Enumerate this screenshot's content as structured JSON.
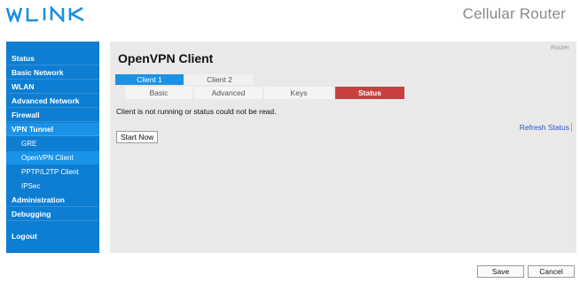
{
  "header": {
    "logo_text": "WLINK",
    "app_title": "Cellular Router"
  },
  "sidebar": {
    "items": [
      {
        "label": "Status"
      },
      {
        "label": "Basic Network"
      },
      {
        "label": "WLAN"
      },
      {
        "label": "Advanced Network"
      },
      {
        "label": "Firewall"
      },
      {
        "label": "VPN Tunnel",
        "active": true
      },
      {
        "label": "Administration"
      },
      {
        "label": "Debugging"
      },
      {
        "label": "Logout"
      }
    ],
    "vpn_subitems": [
      {
        "label": "GRE"
      },
      {
        "label": "OpenVPN Client",
        "selected": true
      },
      {
        "label": "PPTP/L2TP Client"
      },
      {
        "label": "IPSec"
      }
    ]
  },
  "main": {
    "breadcrumb": "Router",
    "title": "OpenVPN Client",
    "client_tabs": [
      {
        "label": "Client 1",
        "active": true
      },
      {
        "label": "Client 2",
        "active": false
      }
    ],
    "section_tabs": [
      {
        "label": "Basic"
      },
      {
        "label": "Advanced"
      },
      {
        "label": "Keys"
      },
      {
        "label": "Status",
        "active": true
      }
    ],
    "status_message": "Client is not running or status could not be read.",
    "refresh_label": "Refresh Status",
    "start_label": "Start Now"
  },
  "footer": {
    "save_label": "Save",
    "cancel_label": "Cancel"
  },
  "colors": {
    "sidebar": "#0d7ed2",
    "active_tab": "#1c92e5",
    "status_tab": "#c64040",
    "panel": "#e9e9e9"
  }
}
